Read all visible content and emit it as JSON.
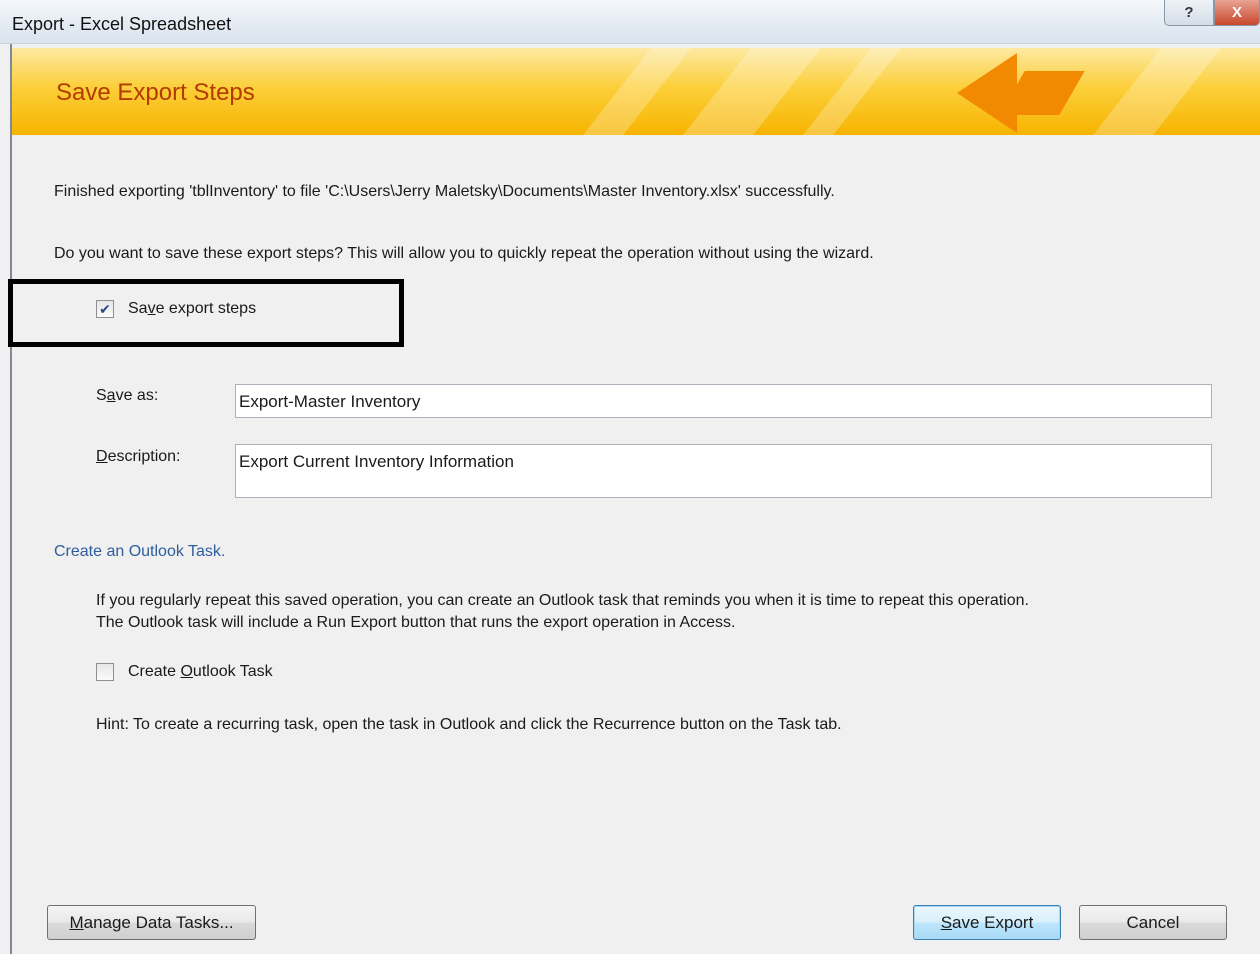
{
  "window": {
    "title": "Export - Excel Spreadsheet",
    "help_glyph": "?",
    "close_glyph": "X"
  },
  "banner": {
    "title": "Save Export Steps"
  },
  "messages": {
    "finished": "Finished exporting 'tblInventory' to file 'C:\\Users\\Jerry Maletsky\\Documents\\Master Inventory.xlsx' successfully.",
    "question": "Do you want to save these export steps? This will allow you to quickly repeat the operation without using the wizard."
  },
  "save_steps": {
    "checked": true,
    "check_glyph": "✔",
    "label_pre": "Sa",
    "label_key": "v",
    "label_post": "e export steps"
  },
  "fields": {
    "save_as": {
      "label_pre": "S",
      "label_key": "a",
      "label_post": "ve as:",
      "value": "Export-Master Inventory"
    },
    "description": {
      "label_key": "D",
      "label_post": "escription:",
      "value": "Export Current Inventory Information"
    }
  },
  "outlook": {
    "link": "Create an Outlook Task.",
    "info_line1": "If you regularly repeat this saved operation, you can create an Outlook task that reminds you when it is time to repeat this operation.",
    "info_line2": "The Outlook task will include a Run Export button that runs the export operation in Access.",
    "checkbox_checked": false,
    "checkbox_label_pre": "Create ",
    "checkbox_label_key": "O",
    "checkbox_label_post": "utlook Task",
    "hint": "Hint: To create a recurring task, open the task in Outlook and click the Recurrence button on the Task tab."
  },
  "buttons": {
    "manage_key": "M",
    "manage_post": "anage Data Tasks...",
    "save_key": "S",
    "save_post": "ave Export",
    "cancel": "Cancel"
  }
}
